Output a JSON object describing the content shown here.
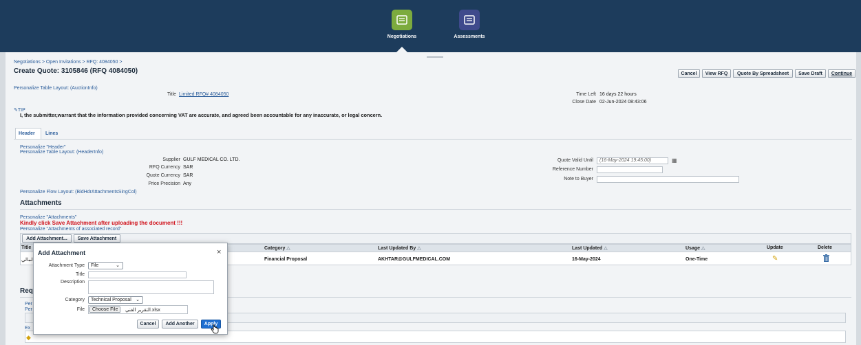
{
  "nav": {
    "items": [
      {
        "label": "Negotiations",
        "color": "#7cab3e"
      },
      {
        "label": "Assessments",
        "color": "#3f4a8c"
      }
    ]
  },
  "breadcrumb": "Negotiations >  Open Invitations >  RFQ: 4084050 >",
  "page_title": "Create Quote: 3105846 (RFQ 4084050)",
  "toolbar": {
    "cancel": "Cancel",
    "view_rfq": "View RFQ",
    "quote_by_spreadsheet": "Quote By Spreadsheet",
    "save_draft": "Save Draft",
    "continue": "Continue"
  },
  "personalize_table_auction": "Personalize Table Layout: (AuctionInfo)",
  "title_label": "Title",
  "title_value": "Limited RFQ# 4084050",
  "time_left_label": "Time Left",
  "time_left_value": "16 days 22 hours",
  "close_date_label": "Close Date",
  "close_date_value": "02-Jun-2024 08:43:06",
  "tip_label": "TIP",
  "tip_text": "I, the submitter,warrant that the information provided concerning VAT are accurate, and agreed been accountable for any inaccurate, or legal concern.",
  "tabs": {
    "header": "Header",
    "lines": "Lines"
  },
  "personalize_header": "Personalize \"Header\"",
  "personalize_table_header": "Personalize Table Layout: (HeaderInfo)",
  "supplier_label": "Supplier",
  "supplier_value": "GULF MEDICAL CO. LTD.",
  "rfq_currency_label": "RFQ Currency",
  "rfq_currency_value": "SAR",
  "quote_currency_label": "Quote Currency",
  "quote_currency_value": "SAR",
  "price_precision_label": "Price Precision",
  "price_precision_value": "Any",
  "quote_valid_label": "Quote Valid Until",
  "quote_valid_placeholder": "(16-May-2024 19:45:00)",
  "reference_number_label": "Reference Number",
  "note_to_buyer_label": "Note to Buyer",
  "personalize_flow": "Personalize Flow Layout: (BidHdrAttachmentsSingCol)",
  "attachments_heading": "Attachments",
  "personalize_attachments": "Personalize \"Attachments\"",
  "save_notice": "Kindly click Save Attachment after uploading the document !!!",
  "personalize_assoc": "Personalize \"Attachments of associated record\"",
  "add_attachment_btn": "Add Attachment...",
  "save_attachment_btn": "Save Attachment",
  "attach_table": {
    "headers": {
      "title": "Title",
      "category": "Category",
      "last_updated_by": "Last Updated By",
      "last_updated": "Last Updated",
      "usage": "Usage",
      "update": "Update",
      "delete": "Delete"
    },
    "row": {
      "title": "المالي",
      "category": "Financial Proposal",
      "last_updated_by": "AKHTAR@GULFMEDICAL.COM",
      "last_updated": "16-May-2024",
      "usage": "One-Time"
    }
  },
  "req_heading_partial": "Req",
  "partial_labels": [
    "Per",
    "Per",
    "Ex"
  ],
  "dialog": {
    "title": "Add Attachment",
    "close": "×",
    "type_label": "Attachment Type",
    "type_value": "File",
    "title_label": "Title",
    "description_label": "Description",
    "category_label": "Category",
    "category_value": "Technical Proposal",
    "file_label": "File",
    "choose_file": "Choose File",
    "file_name": "التقرير الفني.xlsx",
    "cancel": "Cancel",
    "add_another": "Add Another",
    "apply": "Apply"
  }
}
